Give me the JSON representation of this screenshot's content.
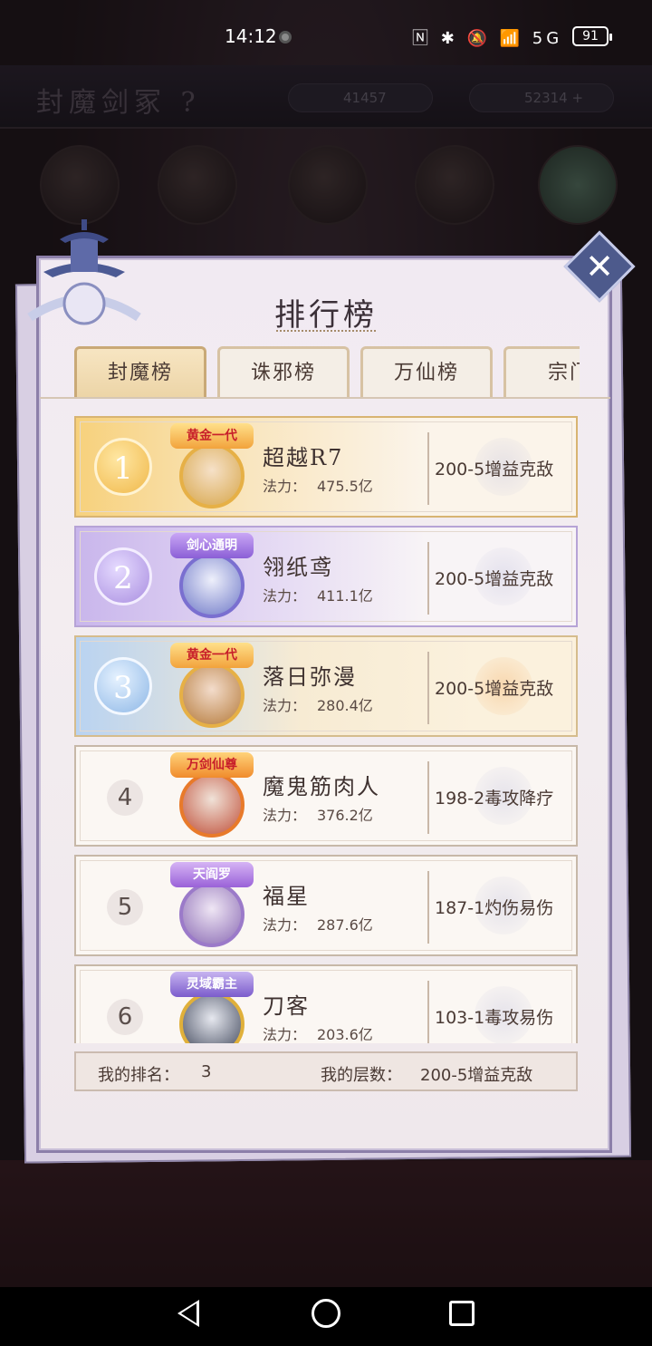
{
  "status_bar": {
    "time": "14:12",
    "icons": "🄽 ✱ 🔕 📶 5G",
    "battery": "91"
  },
  "background": {
    "title": "封魔剑冢 ?",
    "currency_1": "41457",
    "currency_2": "52314 +"
  },
  "panel": {
    "title": "排行榜"
  },
  "tabs": [
    {
      "label": "封魔榜",
      "active": true
    },
    {
      "label": "诛邪榜",
      "active": false
    },
    {
      "label": "万仙榜",
      "active": false
    },
    {
      "label": "宗门",
      "active": false
    }
  ],
  "rankings": [
    {
      "rank": "1",
      "crest": "黄金一代",
      "name": "超越R7",
      "power_label": "法力：",
      "power": "475.5亿",
      "level": "200-5增益克敌"
    },
    {
      "rank": "2",
      "crest": "剑心通明",
      "name": "翎纸鸢",
      "power_label": "法力：",
      "power": "411.1亿",
      "level": "200-5增益克敌"
    },
    {
      "rank": "3",
      "crest": "黄金一代",
      "name": "落日弥漫",
      "power_label": "法力：",
      "power": "280.4亿",
      "level": "200-5增益克敌"
    },
    {
      "rank": "4",
      "crest": "万剑仙尊",
      "name": "魔鬼筋肉人",
      "power_label": "法力：",
      "power": "376.2亿",
      "level": "198-2毒攻降疗"
    },
    {
      "rank": "5",
      "crest": "天阎罗",
      "name": "福星",
      "power_label": "法力：",
      "power": "287.6亿",
      "level": "187-1灼伤易伤"
    },
    {
      "rank": "6",
      "crest": "灵域霸主",
      "name": "刀客",
      "power_label": "法力：",
      "power": "203.6亿",
      "level": "103-1毒攻易伤"
    }
  ],
  "my_info": {
    "rank_label": "我的排名：",
    "rank_value": "3",
    "level_label": "我的层数：",
    "level_value": "200-5增益克敌"
  },
  "colors": {
    "panel_border": "#8c7fa9",
    "close_button": "#4d5a8c",
    "tab_active": "#ecd4a6",
    "gold": "#f0b84a",
    "purple": "#a98ee0",
    "blue": "#8db7e6"
  }
}
